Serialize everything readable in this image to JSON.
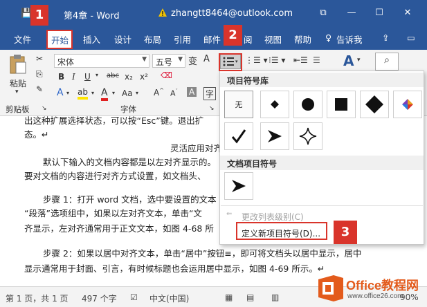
{
  "titlebar": {
    "doc_title": "第4章 - Word",
    "account": "zhangtt8464@outlook.com"
  },
  "tabs": [
    {
      "label": "文件"
    },
    {
      "label": "开始"
    },
    {
      "label": "插入"
    },
    {
      "label": "设计"
    },
    {
      "label": "布局"
    },
    {
      "label": "引用"
    },
    {
      "label": "邮件"
    },
    {
      "label": "阅"
    },
    {
      "label": "视图"
    },
    {
      "label": "帮助"
    },
    {
      "label": "告诉我"
    }
  ],
  "ribbon": {
    "paste_label": "粘贴",
    "clipboard_label": "剪贴板",
    "font_group_label": "字体",
    "font_name": "宋体",
    "font_size": "五号",
    "wen_glyph": "变",
    "font_a_glyph": "A"
  },
  "callouts": {
    "one": "1",
    "two": "2",
    "three": "3"
  },
  "dropdown": {
    "library_title": "项目符号库",
    "none_label": "无",
    "doc_bullets_title": "文档项目符号",
    "change_level": "更改列表级别(C)",
    "define_new": "定义新项目符号(D)..."
  },
  "document": {
    "lines": [
      "出这种扩展选择状态，可以按“Esc”键。退出扩",
      "态。↵",
      "灵活应用对齐",
      "默认下输入的文档内容都是以左对齐显示的。",
      "要对文档的内容进行对齐方式设置，如文档头、",
      "步骤 1：打开 word 文档，选中要设置的文本",
      "“段落”选项组中，如果以左对齐文本，单击“文",
      "齐显示，左对齐通常用于正文文本，如图 4-68 所",
      "步骤 2：如果以居中对齐文本，单击“居中”按钮≡，即可将文档头以居中显示，居中",
      "显示通常用于封面、引言，有时候标题也会运用居中显示，如图 4-69 所示。↵"
    ]
  },
  "status": {
    "page": "第 1 页，共 1 页",
    "words": "497 个字",
    "lang": "中文(中国)",
    "zoom": "90%"
  },
  "watermark": {
    "brand": "Office教程网",
    "url": "www.office26.com"
  },
  "colors": {
    "ribbon_blue": "#2b579a",
    "callout_red": "#d9342b"
  }
}
